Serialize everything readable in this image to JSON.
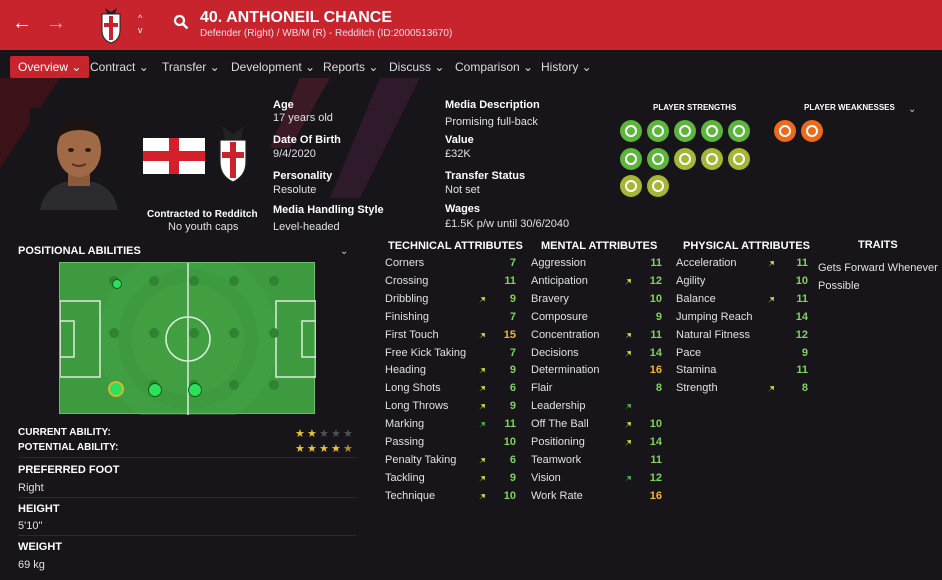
{
  "header": {
    "title": "40. ANTHONEIL CHANCE",
    "subtitle": "Defender (Right) / WB/M (R) - Redditch (ID:2000513670)"
  },
  "nav": {
    "tabs": [
      "Overview",
      "Contract",
      "Transfer",
      "Development",
      "Reports",
      "Discuss",
      "Comparison",
      "History"
    ]
  },
  "profile": {
    "contract_label": "Contracted to Redditch",
    "youth_caps": "No youth caps",
    "age_label": "Age",
    "age_value": "17 years old",
    "dob_label": "Date Of Birth",
    "dob_value": "9/4/2020",
    "personality_label": "Personality",
    "personality_value": "Resolute",
    "media_handling_label": "Media Handling Style",
    "media_handling_value": "Level-headed",
    "media_desc_label": "Media Description",
    "media_desc_value": "Promising full-back",
    "value_label": "Value",
    "value_value": "£32K",
    "transfer_status_label": "Transfer Status",
    "transfer_status_value": "Not set",
    "wages_label": "Wages",
    "wages_value": "£1.5K p/w until 30/6/2040"
  },
  "strengths": {
    "strengths_label": "PLAYER STRENGTHS",
    "weaknesses_label": "PLAYER WEAKNESSES",
    "strength_icons": [
      "ball-control-icon",
      "running-icon",
      "mind-icon",
      "target-icon",
      "pulse-icon",
      "flask-icon",
      "trend-icon",
      "bandage-icon",
      "handshake-icon",
      "pitch-icon",
      "report-icon",
      "report-icon"
    ],
    "weakness_icons": [
      "star-icon",
      "dumbbell-icon"
    ]
  },
  "positional": {
    "title": "POSITIONAL ABILITIES",
    "current_ability_label": "CURRENT ABILITY:",
    "potential_ability_label": "POTENTIAL ABILITY:",
    "current_ability_stars": 2,
    "potential_ability_stars": 4.5,
    "preferred_foot_label": "PREFERRED FOOT",
    "preferred_foot_value": "Right",
    "height_label": "HEIGHT",
    "height_value": "5'10\"",
    "weight_label": "WEIGHT",
    "weight_value": "69 kg"
  },
  "technical": {
    "title": "TECHNICAL ATTRIBUTES",
    "rows": [
      {
        "name": "Corners",
        "value": "7",
        "arrow": ""
      },
      {
        "name": "Crossing",
        "value": "11",
        "arrow": ""
      },
      {
        "name": "Dribbling",
        "value": "9",
        "arrow": "up"
      },
      {
        "name": "Finishing",
        "value": "7",
        "arrow": ""
      },
      {
        "name": "First Touch",
        "value": "15",
        "arrow": "up"
      },
      {
        "name": "Free Kick Taking",
        "value": "7",
        "arrow": ""
      },
      {
        "name": "Heading",
        "value": "9",
        "arrow": "up"
      },
      {
        "name": "Long Shots",
        "value": "6",
        "arrow": "up"
      },
      {
        "name": "Long Throws",
        "value": "9",
        "arrow": "up"
      },
      {
        "name": "Marking",
        "value": "11",
        "arrow": "upg"
      },
      {
        "name": "Passing",
        "value": "10",
        "arrow": ""
      },
      {
        "name": "Penalty Taking",
        "value": "6",
        "arrow": "up"
      },
      {
        "name": "Tackling",
        "value": "9",
        "arrow": "up"
      },
      {
        "name": "Technique",
        "value": "10",
        "arrow": "up"
      }
    ]
  },
  "mental": {
    "title": "MENTAL ATTRIBUTES",
    "rows": [
      {
        "name": "Aggression",
        "value": "11",
        "arrow": ""
      },
      {
        "name": "Anticipation",
        "value": "12",
        "arrow": "up"
      },
      {
        "name": "Bravery",
        "value": "10",
        "arrow": ""
      },
      {
        "name": "Composure",
        "value": "9",
        "arrow": ""
      },
      {
        "name": "Concentration",
        "value": "11",
        "arrow": "up"
      },
      {
        "name": "Decisions",
        "value": "14",
        "arrow": "up"
      },
      {
        "name": "Determination",
        "value": "16",
        "arrow": ""
      },
      {
        "name": "Flair",
        "value": "8",
        "arrow": ""
      },
      {
        "name": "Leadership",
        "value": "",
        "arrow": "upg"
      },
      {
        "name": "Off The Ball",
        "value": "10",
        "arrow": "up"
      },
      {
        "name": "Positioning",
        "value": "14",
        "arrow": "up"
      },
      {
        "name": "Teamwork",
        "value": "11",
        "arrow": ""
      },
      {
        "name": "Vision",
        "value": "12",
        "arrow": "upg"
      },
      {
        "name": "Work Rate",
        "value": "16",
        "arrow": ""
      }
    ]
  },
  "physical": {
    "title": "PHYSICAL ATTRIBUTES",
    "rows": [
      {
        "name": "Acceleration",
        "value": "11",
        "arrow": "up"
      },
      {
        "name": "Agility",
        "value": "10",
        "arrow": ""
      },
      {
        "name": "Balance",
        "value": "11",
        "arrow": "up"
      },
      {
        "name": "Jumping Reach",
        "value": "14",
        "arrow": ""
      },
      {
        "name": "Natural Fitness",
        "value": "12",
        "arrow": ""
      },
      {
        "name": "Pace",
        "value": "9",
        "arrow": ""
      },
      {
        "name": "Stamina",
        "value": "11",
        "arrow": ""
      },
      {
        "name": "Strength",
        "value": "8",
        "arrow": "up"
      }
    ]
  },
  "traits": {
    "title": "TRAITS",
    "items": [
      "Gets Forward Whenever Possible"
    ]
  },
  "colors": {
    "header": "#c8242d",
    "value_normal": "#7ed45a",
    "value_high": "#f4b632",
    "value_low": "#e0e0e4",
    "strength_icon": "#5db53c",
    "strength_icon_yellow": "#a5b534",
    "weakness_icon": "#ec6a1c"
  }
}
